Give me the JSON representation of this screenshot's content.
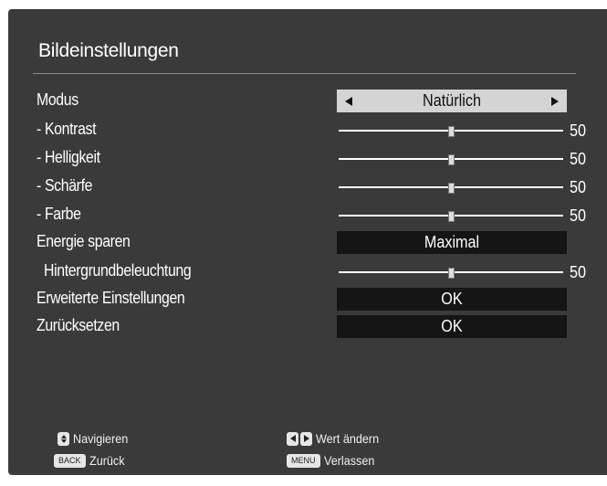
{
  "menu": {
    "title": "Bildeinstellungen",
    "rows": [
      {
        "label": "Modus",
        "control": "select",
        "value": "Natürlich",
        "highlighted": true
      },
      {
        "label": "- Kontrast",
        "control": "slider",
        "value": "50",
        "level": 0.5
      },
      {
        "label": "- Helligkeit",
        "control": "slider",
        "value": "50",
        "level": 0.5
      },
      {
        "label": "- Schärfe",
        "control": "slider",
        "value": "50",
        "level": 0.5
      },
      {
        "label": "- Farbe",
        "control": "slider",
        "value": "50",
        "level": 0.5
      },
      {
        "label": "Energie sparen",
        "control": "select",
        "value": "Maximal"
      },
      {
        "label": "Hintergrundbeleuchtung",
        "control": "slider",
        "value": "50",
        "level": 0.5,
        "indent": true
      },
      {
        "label": "Erweiterte Einstellungen",
        "control": "select",
        "value": "OK"
      },
      {
        "label": "Zurücksetzen",
        "control": "select",
        "value": "OK"
      }
    ]
  },
  "footer": {
    "navigate": {
      "icon": "up-down-icon",
      "label": "Navigieren"
    },
    "back": {
      "key": "BACK",
      "label": "Zurück"
    },
    "change": {
      "icon": "left-right-icon",
      "label": "Wert ändern"
    },
    "exit": {
      "key": "MENU",
      "label": "Verlassen"
    }
  },
  "colors": {
    "panel": "#3a3a3a",
    "field": "#151515",
    "highlight": "#d4d4d4",
    "text": "#ffffff"
  }
}
